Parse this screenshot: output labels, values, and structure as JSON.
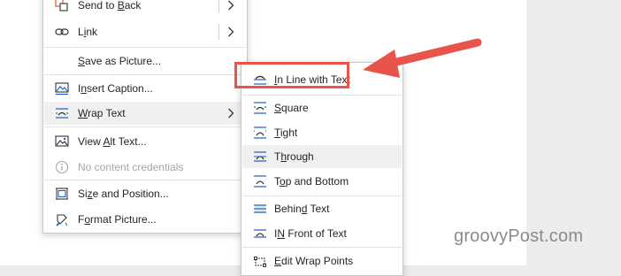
{
  "context_menu": {
    "items": [
      {
        "key": "B",
        "label_after": "ack",
        "label_before": "Send to ",
        "icon": "send-to-back-icon",
        "has_submenu": true
      },
      {
        "key": "i",
        "label_before": "L",
        "label_after": "nk",
        "icon": "link-icon",
        "has_submenu": true
      },
      {
        "key": "S",
        "label_before": "",
        "label_after": "ave as Picture...",
        "icon": ""
      },
      {
        "key": "n",
        "label_before": "I",
        "label_after": "sert Caption...",
        "icon": "insert-caption-icon"
      },
      {
        "key": "W",
        "label_before": "",
        "label_after": "rap Text",
        "icon": "wrap-text-icon",
        "has_submenu": true
      },
      {
        "key": "A",
        "label_before": "View ",
        "label_after": "lt Text...",
        "icon": "view-alt-text-icon"
      },
      {
        "label": "No content credentials",
        "icon": "info-icon",
        "disabled": true
      },
      {
        "key": "z",
        "label_before": "Si",
        "label_after": "e and Position...",
        "icon": "size-position-icon"
      },
      {
        "key": "o",
        "label_before": "F",
        "label_after": "rmat Picture...",
        "icon": "format-picture-icon"
      }
    ]
  },
  "wrap_submenu": {
    "items": [
      {
        "key": "I",
        "label_before": "",
        "label_after": "n Line with Text",
        "icon": "in-line-with-text-icon"
      },
      {
        "key": "S",
        "label_before": "",
        "label_after": "quare",
        "icon": "square-wrap-icon"
      },
      {
        "key": "T",
        "label_before": "",
        "label_after": "ight",
        "icon": "tight-wrap-icon"
      },
      {
        "key": "h",
        "label_before": "T",
        "label_after": "rough",
        "icon": "through-wrap-icon"
      },
      {
        "key": "o",
        "label_before": "T",
        "label_after": "p and Bottom",
        "icon": "top-bottom-wrap-icon"
      },
      {
        "key": "d",
        "label_before": "Behin",
        "label_after": " Text",
        "icon": "behind-text-icon"
      },
      {
        "key": "N",
        "label_before": "I",
        "label_after": " Front of Text",
        "icon": "in-front-of-text-icon"
      },
      {
        "key": "E",
        "label_before": "",
        "label_after": "dit Wrap Points",
        "icon": "edit-wrap-points-icon"
      }
    ]
  },
  "watermark": {
    "text": "groovyPost.com"
  },
  "colors": {
    "annotation": "#e8544a",
    "icon_blue": "#1f5fb4",
    "hover": "#f0f0f0"
  }
}
